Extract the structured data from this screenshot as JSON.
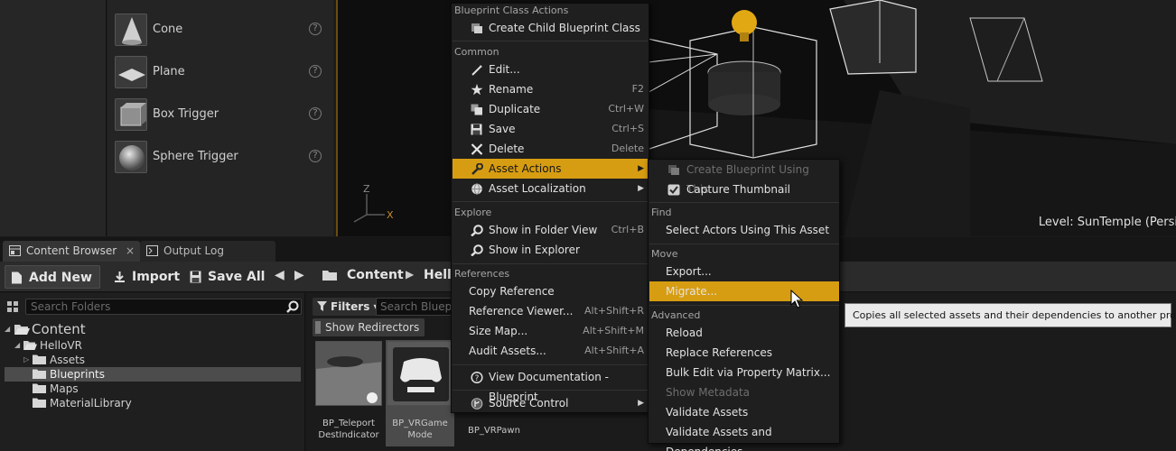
{
  "place_panel": {
    "items": [
      {
        "label": "Cone"
      },
      {
        "label": "Plane"
      },
      {
        "label": "Box Trigger"
      },
      {
        "label": "Sphere Trigger"
      }
    ],
    "help_glyph": "?"
  },
  "viewport": {
    "level_label": "Level:  SunTemple (Persi",
    "axis_z": "Z",
    "axis_x": "X"
  },
  "tabs": {
    "content_browser": "Content Browser",
    "output_log": "Output Log",
    "close_glyph": "×"
  },
  "toolbar": {
    "add_new": "Add New ▾",
    "import": "Import",
    "save_all": "Save All",
    "back_glyph": "◀",
    "forward_glyph": "▶",
    "breadcrumb": [
      "Content",
      "Hello"
    ],
    "breadcrumb_sep": "▶"
  },
  "folder_tree": {
    "search_placeholder": "Search Folders",
    "items": [
      {
        "label": "Content"
      },
      {
        "label": "HelloVR"
      },
      {
        "label": "Assets"
      },
      {
        "label": "Blueprints"
      },
      {
        "label": "Maps"
      },
      {
        "label": "MaterialLibrary"
      }
    ]
  },
  "asset_view": {
    "filters_label": "Filters ▾",
    "search_placeholder": "Search Blueprints",
    "show_redirectors": "Show Redirectors",
    "assets": [
      {
        "name": "BP_Teleport DestIndicator"
      },
      {
        "name": "BP_VRGame Mode"
      },
      {
        "name": "BP_VRPawn"
      }
    ]
  },
  "context_menu": {
    "sections": {
      "blueprint_class_actions": "Blueprint Class Actions",
      "common": "Common",
      "explore": "Explore",
      "references": "References"
    },
    "items": {
      "create_child": {
        "label": "Create Child Blueprint Class"
      },
      "edit": {
        "label": "Edit..."
      },
      "rename": {
        "label": "Rename",
        "shortcut": "F2"
      },
      "duplicate": {
        "label": "Duplicate",
        "shortcut": "Ctrl+W"
      },
      "save": {
        "label": "Save",
        "shortcut": "Ctrl+S"
      },
      "delete": {
        "label": "Delete",
        "shortcut": "Delete"
      },
      "asset_actions": {
        "label": "Asset Actions"
      },
      "asset_localization": {
        "label": "Asset Localization"
      },
      "show_in_folder_view": {
        "label": "Show in Folder View",
        "shortcut": "Ctrl+B"
      },
      "show_in_explorer": {
        "label": "Show in Explorer"
      },
      "copy_reference": {
        "label": "Copy Reference"
      },
      "reference_viewer": {
        "label": "Reference Viewer...",
        "shortcut": "Alt+Shift+R"
      },
      "size_map": {
        "label": "Size Map...",
        "shortcut": "Alt+Shift+M"
      },
      "audit_assets": {
        "label": "Audit Assets...",
        "shortcut": "Alt+Shift+A"
      },
      "view_documentation": {
        "label": "View Documentation - Blueprint"
      },
      "source_control": {
        "label": "Source Control"
      }
    },
    "submenu_arrow": "▶"
  },
  "sub_menu": {
    "sections": {
      "find": "Find",
      "move": "Move",
      "advanced": "Advanced"
    },
    "items": {
      "create_blueprint_using": {
        "label": "Create Blueprint Using This...",
        "enabled": false
      },
      "capture_thumbnail": {
        "label": "Capture Thumbnail"
      },
      "select_actors": {
        "label": "Select Actors Using This Asset"
      },
      "export": {
        "label": "Export..."
      },
      "migrate": {
        "label": "Migrate..."
      },
      "reload": {
        "label": "Reload"
      },
      "replace_references": {
        "label": "Replace References"
      },
      "bulk_edit": {
        "label": "Bulk Edit via Property Matrix..."
      },
      "show_metadata": {
        "label": "Show Metadata",
        "enabled": false
      },
      "validate_assets": {
        "label": "Validate Assets"
      },
      "validate_assets_deps": {
        "label": "Validate Assets and Dependencies"
      }
    }
  },
  "tooltip": {
    "text": "Copies all selected assets and their dependencies to another project"
  },
  "colors": {
    "highlight": "#d79d12",
    "menu_bg": "#1f1f1f",
    "panel_bg": "#242424",
    "viewport_border": "#6b4c10"
  },
  "icons": {
    "menu": [
      "blueprint-icon",
      "pencil-icon",
      "rename-star-icon",
      "duplicate-icon",
      "save-icon",
      "delete-x-icon",
      "wrench-icon",
      "globe-icon",
      "search-magnifier-icon",
      "search-magnifier-icon",
      "help-book-icon",
      "source-control-icon"
    ],
    "sub_menu": [
      "blueprint-icon",
      "checkbox-icon"
    ]
  }
}
